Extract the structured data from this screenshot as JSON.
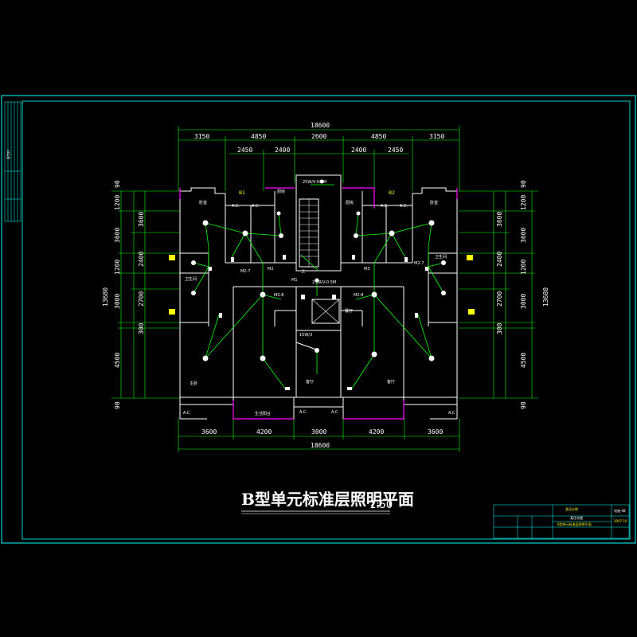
{
  "drawing": {
    "title": "B型单元标准层照明平面",
    "scale": "1:50",
    "colors": {
      "background": "#000000",
      "frame": "#00ffff",
      "walls": "#ffffff",
      "wiring": "#00ff00",
      "highlight": "#ff00ff",
      "accent": "#ffff00"
    }
  },
  "dims": {
    "top_total": "18600",
    "top_row2": [
      "3150",
      "4850",
      "2600",
      "4850",
      "3150"
    ],
    "top_row3": [
      "2450",
      "2400",
      "2400",
      "2450"
    ],
    "bottom_row": [
      "3600",
      "4200",
      "3000",
      "4200",
      "3600"
    ],
    "bottom_total": "18600",
    "left_outer": "13680",
    "left_row": [
      "90",
      "1200",
      "3600",
      "1200",
      "3000",
      "300",
      "4500",
      "90"
    ],
    "left_inner": [
      "3600",
      "2400",
      "2700"
    ],
    "right_outer": "13680",
    "right_row": [
      "90",
      "1200",
      "3600",
      "1200",
      "3000",
      "300",
      "4500",
      "90"
    ],
    "right_inner": [
      "3600",
      "2400",
      "2700"
    ]
  },
  "labels": {
    "unit_left": "B1",
    "unit_right": "B2",
    "ac": "A.C",
    "ac_dot": "A.C.",
    "stair_top": "25W/V-0.3M",
    "stair_mid": "25W/V-0.5M",
    "elevator": "15W/3",
    "m2_7": "M2-7",
    "m2_8": "M2-8",
    "m2": "M2",
    "m3": "M3",
    "m1": "M1",
    "stair_up": "上",
    "wc": "卫生间",
    "master_bed": "主卧",
    "bed": "卧室",
    "living": "客厅",
    "dining": "餐厅",
    "balcony": "生活阳台",
    "kitchen": "厨房"
  },
  "titleblock": {
    "company": "某设计院",
    "project": "某住宅楼",
    "drawing_name": "B型单元标准层照明平面",
    "drawing_no": "电施-08",
    "date": "2007.10",
    "left_sign": "签字栏"
  }
}
